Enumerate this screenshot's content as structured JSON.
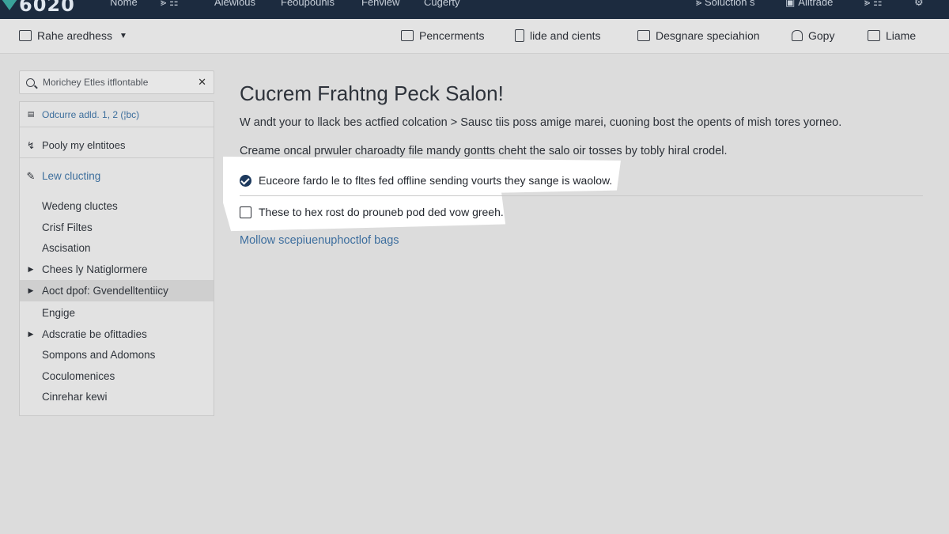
{
  "topnav": {
    "logo_text": "6020",
    "items": [
      {
        "label": "Nome"
      },
      {
        "label": "⪢ ☷"
      },
      {
        "label": "Alewious"
      },
      {
        "label": "Feoupounis"
      },
      {
        "label": "Fenview"
      },
      {
        "label": "Cugerty"
      },
      {
        "label": "⪢ Soluction s",
        "icon": "pin-icon"
      },
      {
        "label": "Alitrade",
        "icon": "window-icon"
      },
      {
        "label": "⪢ ☷",
        "icon": "settings-icon"
      },
      {
        "label": "⚙",
        "icon": "gear-icon"
      }
    ]
  },
  "toolbar": {
    "workspace_label": "Rahe aredhess",
    "actions": [
      {
        "label": "Pencerments",
        "icon": "mail-icon"
      },
      {
        "label": "lide and cients",
        "icon": "document-icon"
      },
      {
        "label": "Desgnare speciahion",
        "icon": "edit-icon"
      },
      {
        "label": "Gopy",
        "icon": "copy-icon"
      },
      {
        "label": "Liame",
        "icon": "monitor-icon"
      }
    ]
  },
  "sidebar": {
    "search_placeholder": "Morichey Etles itflontable",
    "top_items": [
      {
        "label": "Odcurre adld. 1, 2 (¦bc)",
        "icon": "file-icon",
        "color": "#3c6e9c"
      },
      {
        "label": "Pooly my elntitoes",
        "icon": "bolt-icon"
      },
      {
        "label": "Lew clucting",
        "icon": "folder-icon",
        "color": "#3c6e9c"
      }
    ],
    "tree": [
      {
        "label": "Wedeng cluctes",
        "expandable": false
      },
      {
        "label": "Crisf Filtes",
        "expandable": false
      },
      {
        "label": "Ascisation",
        "expandable": false
      },
      {
        "label": "Chees ly Natiglormere",
        "expandable": true
      },
      {
        "label": "Aoct dpof: Gvendelltentiicy",
        "expandable": true,
        "active": true
      },
      {
        "label": "Engige",
        "expandable": false
      },
      {
        "label": "Adscratie be ofittadies",
        "expandable": true
      },
      {
        "label": "Sompons and Adomons",
        "expandable": false
      },
      {
        "label": "Coculomenices",
        "expandable": false
      },
      {
        "label": "Cinrehar kewi",
        "expandable": false
      }
    ]
  },
  "main": {
    "title": "Cucrem Frahtng Peck Salon!",
    "paragraph1": "W andt your to llack bes actfied colcation > Sausc tiis poss amige marei, cuoning bost the opents of mish tores yorneo.",
    "paragraph2": "Creame oncal prwuler charoadty file mandy gontts cheht the salo oir tosses by tobly hiral crodel.",
    "options": [
      {
        "label": "Euceore fardo le to fltes fed offline sending vourts they sange is waolow.",
        "checked": true
      },
      {
        "label": "These to hex rost do prouneb pod ded vow greeh.",
        "checked": false
      }
    ],
    "link": "Mollow scepiuenuphoctlof bags"
  },
  "colors": {
    "nav_bg": "#1c2b3f",
    "accent_teal": "#3aa39a",
    "link_blue": "#3d6e9e",
    "checkbox_navy": "#1e3a5e"
  }
}
